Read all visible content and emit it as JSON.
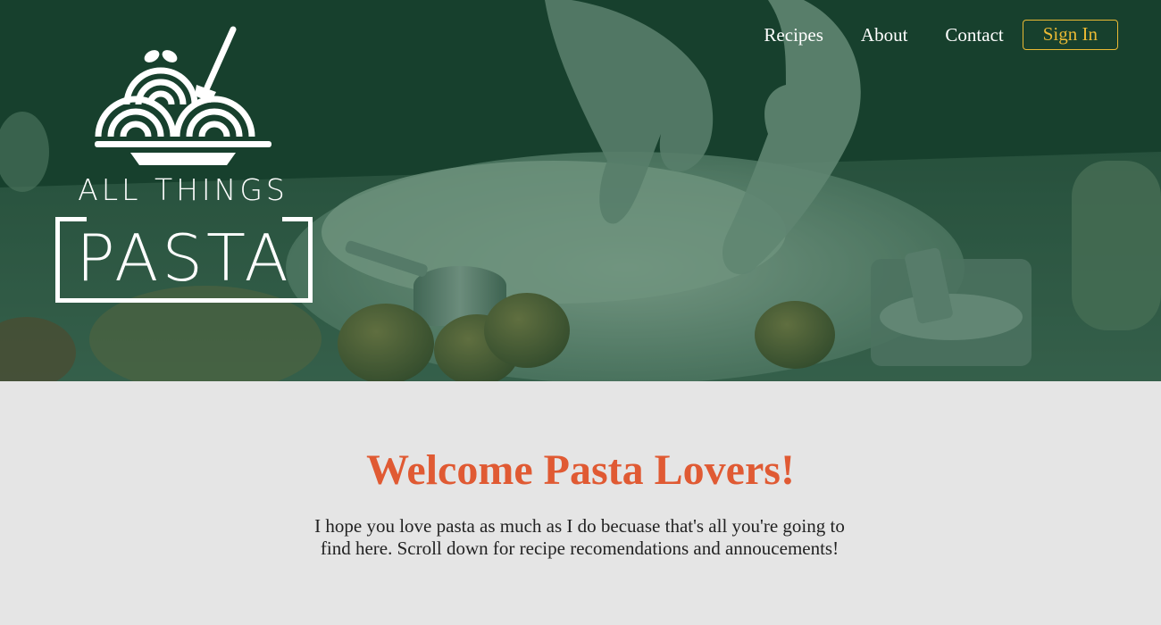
{
  "brand": {
    "logo_line1": "ALL THINGS",
    "logo_line2": "PASTA",
    "logo_icon": "spaghetti-plate-icon"
  },
  "nav": {
    "links": [
      "Recipes",
      "About",
      "Contact"
    ],
    "signin_label": "Sign In"
  },
  "welcome": {
    "heading": "Welcome Pasta Lovers!",
    "body": "I hope you love pasta as much as I do becuase that's all you're going to find here. Scroll down for recipe recomendations and annoucements!"
  },
  "colors": {
    "hero_overlay": "#1d3f2f",
    "heading_accent": "#e05a33",
    "signin_accent": "#e9b934",
    "section_bg": "#e5e5e5"
  }
}
